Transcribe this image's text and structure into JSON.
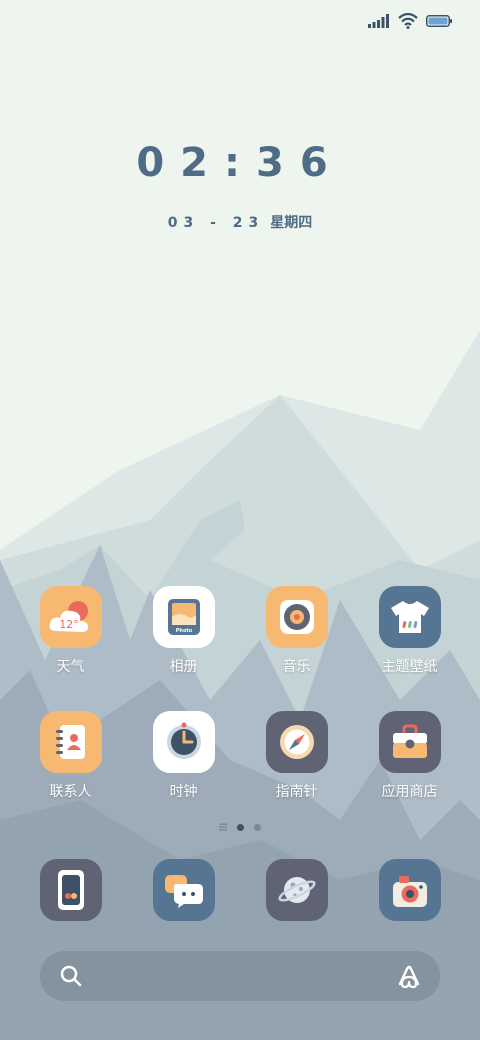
{
  "status_bar": {
    "icons": [
      "signal-icon",
      "wifi-icon",
      "battery-icon"
    ]
  },
  "lockscreen": {
    "time": "02:36",
    "date": "03 - 23",
    "weekday": "星期四"
  },
  "apps_row1": [
    {
      "name": "weather",
      "label": "天气",
      "icon_text": "12°"
    },
    {
      "name": "photos",
      "label": "相册",
      "icon_text": "Photo"
    },
    {
      "name": "music",
      "label": "音乐"
    },
    {
      "name": "themes",
      "label": "主题壁纸"
    }
  ],
  "apps_row2": [
    {
      "name": "contacts",
      "label": "联系人"
    },
    {
      "name": "clock",
      "label": "时钟"
    },
    {
      "name": "compass",
      "label": "指南针"
    },
    {
      "name": "app-store",
      "label": "应用商店"
    }
  ],
  "page_indicator": {
    "pages": 2,
    "current": 1
  },
  "dock": [
    "phone",
    "messages",
    "browser",
    "camera"
  ],
  "colors": {
    "sky": "#eef5ef",
    "text_accent": "#4f6b85",
    "icon_orange": "#f7b971",
    "icon_slate": "#5f6374",
    "icon_blue": "#557593",
    "icon_white": "#ffffff",
    "red": "#ec6a5b"
  }
}
